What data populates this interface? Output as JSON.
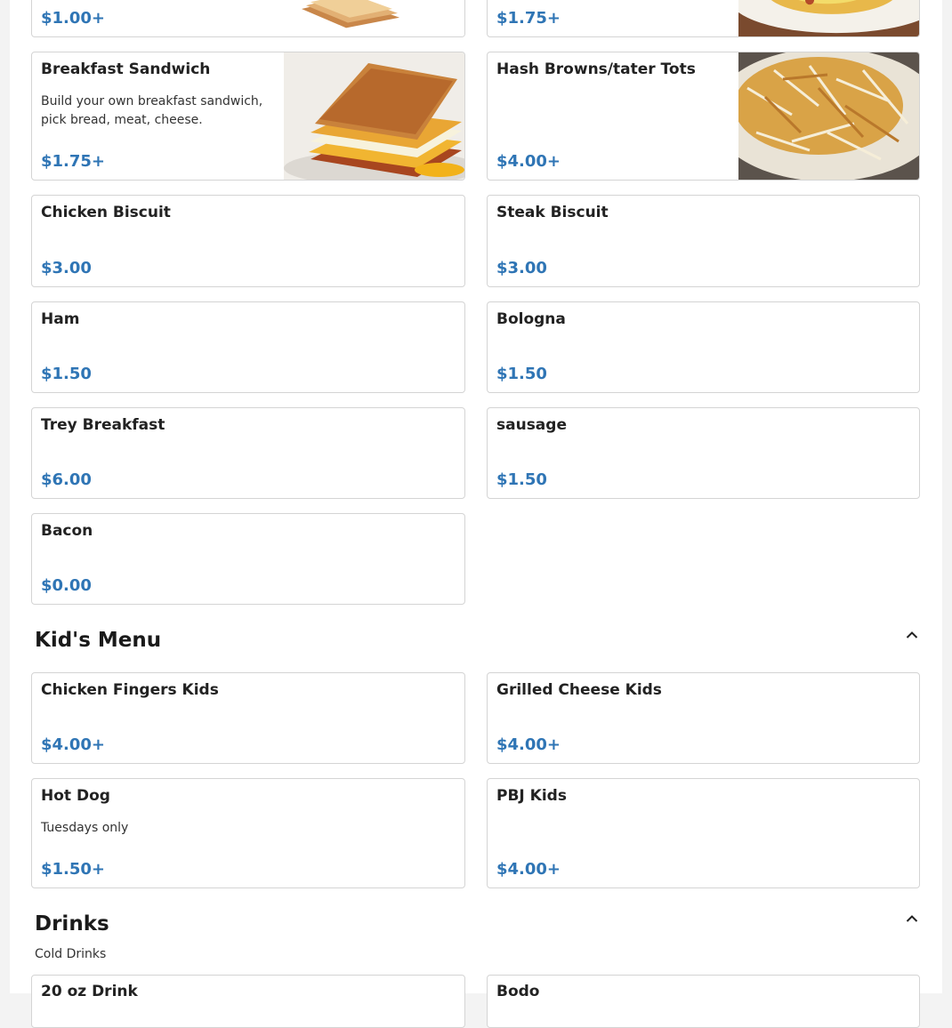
{
  "breakfast_items": [
    {
      "name": "",
      "price": "$1.00+",
      "image": "toast-photo"
    },
    {
      "name": "",
      "price": "$1.75+",
      "image": "omelet-photo"
    },
    {
      "name": "Breakfast Sandwich",
      "description": "Build your own breakfast sandwich, pick bread, meat, cheese.",
      "price": "$1.75+",
      "image": "breakfast-sandwich-photo"
    },
    {
      "name": "Hash Browns/tater Tots",
      "price": "$4.00+",
      "image": "hash-browns-photo"
    },
    {
      "name": "Chicken Biscuit",
      "price": "$3.00"
    },
    {
      "name": "Steak Biscuit",
      "price": "$3.00"
    },
    {
      "name": "Ham",
      "price": "$1.50"
    },
    {
      "name": "Bologna",
      "price": "$1.50"
    },
    {
      "name": "Trey Breakfast",
      "price": "$6.00"
    },
    {
      "name": "sausage",
      "price": "$1.50"
    },
    {
      "name": "Bacon",
      "price": "$0.00"
    }
  ],
  "kids_menu": {
    "title": "Kid's Menu",
    "collapse_icon": "chevron-up-icon",
    "items": [
      {
        "name": "Chicken Fingers Kids",
        "price": "$4.00+"
      },
      {
        "name": "Grilled Cheese Kids",
        "price": "$4.00+"
      },
      {
        "name": "Hot Dog",
        "description": "Tuesdays only",
        "price": "$1.50+"
      },
      {
        "name": "PBJ Kids",
        "price": "$4.00+"
      }
    ]
  },
  "drinks": {
    "title": "Drinks",
    "subtitle": "Cold Drinks",
    "collapse_icon": "chevron-up-icon",
    "items": [
      {
        "name": "20 oz Drink"
      },
      {
        "name": "Bodo"
      }
    ]
  },
  "colors": {
    "price": "#2f75b5",
    "card_border": "#d4d4d4",
    "page_background": "#f3f3f3"
  }
}
